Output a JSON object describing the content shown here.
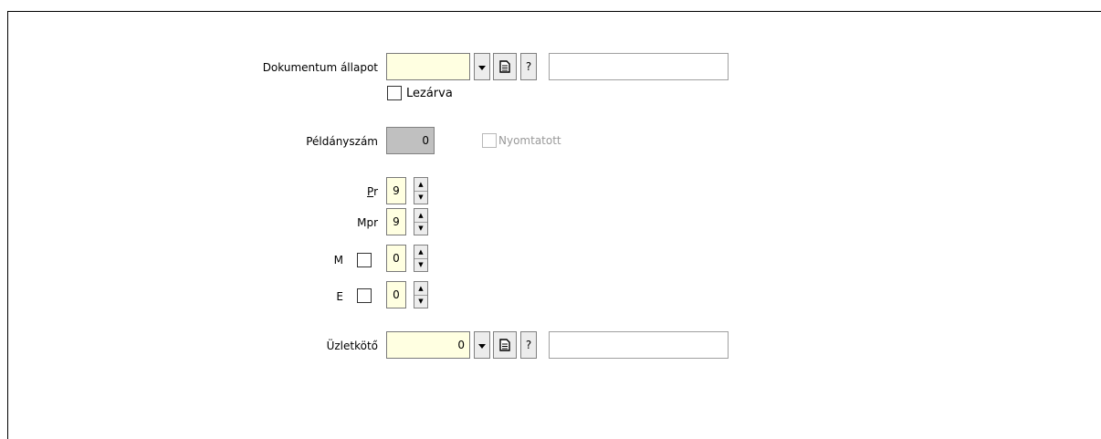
{
  "form": {
    "dokumentum_allapot": {
      "label": "Dokumentum állapot",
      "value": "",
      "dropdown_icon": "chevron-down-icon",
      "doc_icon": "document-icon",
      "help_label": "?",
      "desc_value": ""
    },
    "lezarva": {
      "label": "Lezárva",
      "checked": false
    },
    "peldanyszam": {
      "label": "Példányszám",
      "value": "0"
    },
    "nyomtatott": {
      "label": "Nyomtatott",
      "checked": false,
      "disabled": true
    },
    "pr": {
      "label_mnemonic": "P",
      "label_rest": "r",
      "value": "9"
    },
    "mpr": {
      "label": "Mpr",
      "value": "9"
    },
    "m": {
      "label": "M",
      "checked": false,
      "value": "0"
    },
    "e": {
      "label": "E",
      "checked": false,
      "value": "0"
    },
    "uzletkoto": {
      "label": "Üzletkötő",
      "value": "0",
      "dropdown_icon": "chevron-down-icon",
      "doc_icon": "document-icon",
      "help_label": "?",
      "desc_value": ""
    }
  },
  "colors": {
    "required_field": "#ffffe1",
    "readonly_field": "#c0c0c0",
    "button_face": "#ececec"
  }
}
